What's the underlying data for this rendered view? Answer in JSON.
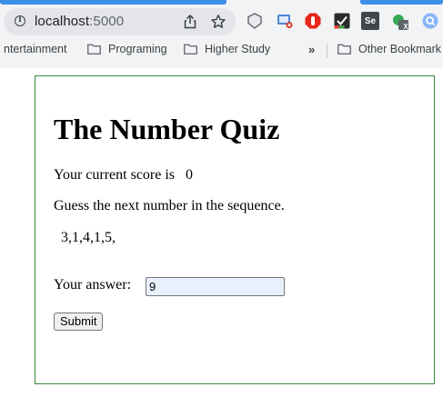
{
  "browser": {
    "address_bar": {
      "host": "localhost",
      "port": ":5000"
    },
    "address_icons": [
      "info-icon",
      "share-icon",
      "bookmark-star-icon"
    ],
    "extensions": [
      "shield-extension-icon",
      "cast-extension-icon",
      "red-stop-extension-icon",
      "checklist-extension-icon",
      "selenium-extension-icon",
      "record-extension-icon",
      "search-extension-icon"
    ],
    "extension_labels": {
      "selenium": "Se",
      "record_badge": "X"
    },
    "bookmarks": [
      {
        "label": "ntertainment",
        "icon": "none"
      },
      {
        "label": "Programing",
        "icon": "folder-icon"
      },
      {
        "label": "Higher Study",
        "icon": "folder-icon"
      }
    ],
    "bookmarks_overflow": "»",
    "other_bookmarks": "Other Bookmark"
  },
  "quiz": {
    "title": "The Number Quiz",
    "score_label": "Your current score is",
    "score_value": "0",
    "instruction": "Guess the next number in the sequence.",
    "sequence": "3,1,4,1,5,",
    "answer_label": "Your answer:",
    "answer_value": "9",
    "submit_label": "Submit"
  },
  "colors": {
    "tab_accent": "#3c8ee8",
    "chrome_bg": "#f1f3f4",
    "omnibox_bg": "#e3e5e8",
    "quiz_border": "#3a8a3a",
    "input_autofill_bg": "#e8f0fe"
  }
}
